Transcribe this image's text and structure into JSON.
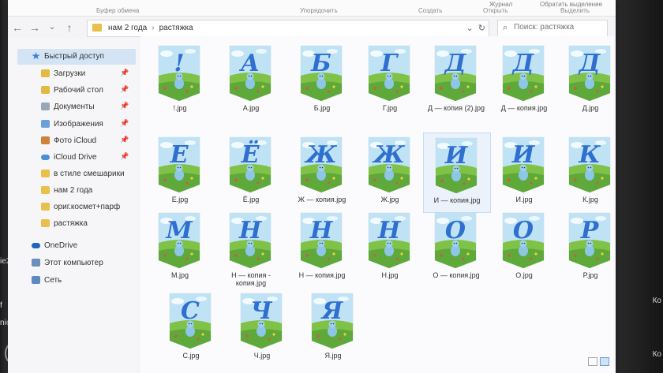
{
  "ribbon": {
    "group_labels": [
      "Буфер обмена",
      "Упорядочить",
      "Создать",
      "Открыть",
      "Выделить"
    ],
    "buttons": [
      "Журнал",
      "Обратить выделение"
    ]
  },
  "address": {
    "crumbs": [
      "нам 2 года",
      "растяжка"
    ],
    "separator": "›",
    "dropdown_glyph": "⌄",
    "refresh_glyph": "↻"
  },
  "search": {
    "placeholder": "Поиск: растяжка"
  },
  "nav_glyphs": {
    "back": "←",
    "forward": "→",
    "recent": "⌄",
    "up": "↑",
    "pin": "📌"
  },
  "sidebar": {
    "items": [
      {
        "label": "Быстрый доступ",
        "icon": "star-icon",
        "pinned": false,
        "selected": true
      },
      {
        "label": "Загрузки",
        "icon": "download-folder-icon",
        "pinned": true
      },
      {
        "label": "Рабочий стол",
        "icon": "desktop-folder-icon",
        "pinned": true
      },
      {
        "label": "Документы",
        "icon": "documents-folder-icon",
        "pinned": true
      },
      {
        "label": "Изображения",
        "icon": "pictures-folder-icon",
        "pinned": true
      },
      {
        "label": "Фото iCloud",
        "icon": "icloud-photos-icon",
        "pinned": true
      },
      {
        "label": "iCloud Drive",
        "icon": "icloud-drive-icon",
        "pinned": true
      },
      {
        "label": "в стиле смешарики",
        "icon": "folder-icon",
        "pinned": false
      },
      {
        "label": "нам 2 года",
        "icon": "folder-icon",
        "pinned": false
      },
      {
        "label": "ориг.космет+парф",
        "icon": "folder-icon",
        "pinned": false
      },
      {
        "label": "растяжка",
        "icon": "folder-icon",
        "pinned": false
      },
      {
        "label": "OneDrive",
        "icon": "onedrive-icon",
        "pinned": false
      },
      {
        "label": "Этот компьютер",
        "icon": "computer-icon",
        "pinned": false
      },
      {
        "label": "Сеть",
        "icon": "network-icon",
        "pinned": false
      }
    ]
  },
  "files": [
    {
      "name": "!.jpg",
      "letter": "!"
    },
    {
      "name": "А.jpg",
      "letter": "А"
    },
    {
      "name": "Б.jpg",
      "letter": "Б"
    },
    {
      "name": "Г.jpg",
      "letter": "Г"
    },
    {
      "name": "Д — копия (2).jpg",
      "letter": "Д"
    },
    {
      "name": "Д — копия.jpg",
      "letter": "Д"
    },
    {
      "name": "Д.jpg",
      "letter": "Д"
    },
    {
      "name": "Е.jpg",
      "letter": "Е"
    },
    {
      "name": "Ё.jpg",
      "letter": "Ё"
    },
    {
      "name": "Ж — копия.jpg",
      "letter": "Ж"
    },
    {
      "name": "Ж.jpg",
      "letter": "Ж"
    },
    {
      "name": "И — копия.jpg",
      "letter": "И",
      "selected": true
    },
    {
      "name": "И.jpg",
      "letter": "И"
    },
    {
      "name": "К.jpg",
      "letter": "К"
    },
    {
      "name": "М.jpg",
      "letter": "М"
    },
    {
      "name": "Н — копия - копия.jpg",
      "letter": "Н"
    },
    {
      "name": "Н — копия.jpg",
      "letter": "Н"
    },
    {
      "name": "Н.jpg",
      "letter": "Н"
    },
    {
      "name": "О — копия.jpg",
      "letter": "О"
    },
    {
      "name": "О.jpg",
      "letter": "О"
    },
    {
      "name": "Р.jpg",
      "letter": "Р"
    },
    {
      "name": "С.jpg",
      "letter": "С"
    },
    {
      "name": "Ч.jpg",
      "letter": "Ч"
    },
    {
      "name": "Я.jpg",
      "letter": "Я"
    }
  ],
  "photo_context": {
    "left_fragments": [
      "ie2",
      "nie1",
      "f"
    ],
    "right_fragments": [
      "Ко",
      "Ко"
    ]
  },
  "colors": {
    "selection": "#d4e4f5",
    "letter": "#2f6fd0",
    "sky": "#bfe3f5",
    "grass": "#7fc247",
    "folder": "#e8c04a"
  }
}
